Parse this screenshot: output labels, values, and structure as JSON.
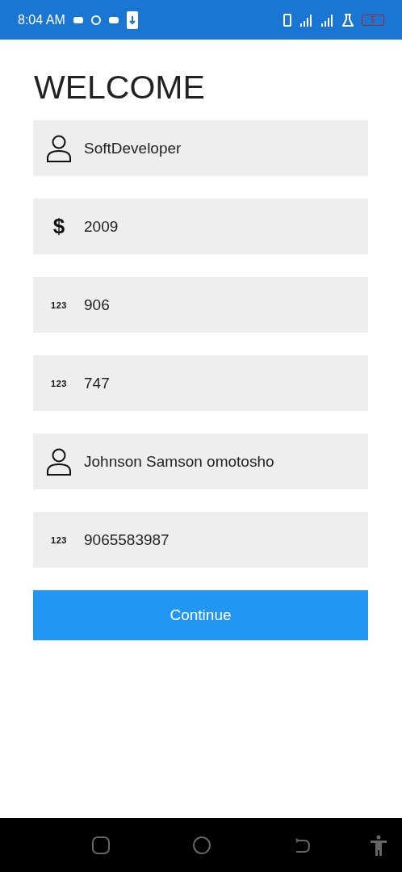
{
  "status_bar": {
    "time": "8:04 AM",
    "battery": "5"
  },
  "title": "WELCOME",
  "fields": [
    {
      "kind": "person",
      "value": "SoftDeveloper"
    },
    {
      "kind": "glyph",
      "glyph": "$",
      "value": "2009"
    },
    {
      "kind": "glyph",
      "glyph": "123",
      "value": "906"
    },
    {
      "kind": "glyph",
      "glyph": "123",
      "value": "747"
    },
    {
      "kind": "person",
      "value": "Johnson Samson omotosho"
    },
    {
      "kind": "glyph",
      "glyph": "123",
      "value": "9065583987"
    }
  ],
  "button": "Continue"
}
